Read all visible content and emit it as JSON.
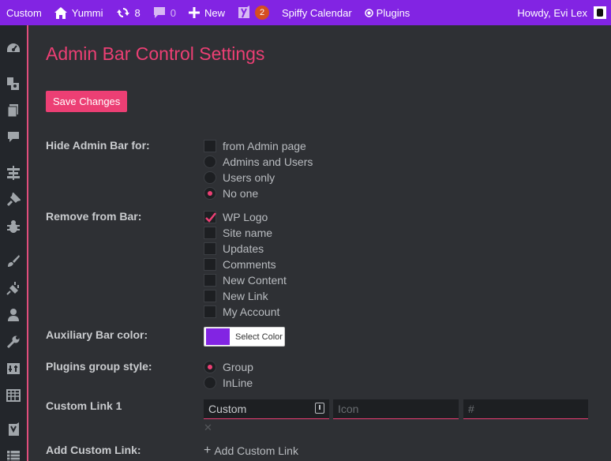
{
  "admin_bar": {
    "site_title": "Custom",
    "home_label": "Yummi",
    "updates_count": "8",
    "comments_count": "0",
    "new_label": "New",
    "yoast_badge": "2",
    "calendar_label": "Spiffy Calendar",
    "plugins_label": "Plugins",
    "greeting": "Howdy, Evi Lex",
    "bar_color": "#8224e3"
  },
  "sidebar": {
    "items": [
      "dashboard-icon",
      "yoast-icon",
      "pages-icon",
      "comments-icon",
      "woo-icon",
      "pin-icon",
      "bug-icon",
      "appearance-icon",
      "plugins-icon",
      "users-icon",
      "tools-icon",
      "settings-icon",
      "calendar-table-icon",
      "yoast-seo-icon",
      "list-icon"
    ]
  },
  "page": {
    "title": "Admin Bar Control Settings",
    "save_label": "Save Changes",
    "accent_color": "#ec3f74"
  },
  "hide_admin_bar": {
    "label": "Hide Admin Bar for:",
    "options": [
      {
        "label": "from Admin page",
        "type": "checkbox",
        "checked": false
      },
      {
        "label": "Admins and Users",
        "type": "radio",
        "checked": false
      },
      {
        "label": "Users only",
        "type": "radio",
        "checked": false
      },
      {
        "label": "No one",
        "type": "radio",
        "checked": true
      }
    ]
  },
  "remove_from_bar": {
    "label": "Remove from Bar:",
    "options": [
      {
        "label": "WP Logo",
        "checked": true
      },
      {
        "label": "Site name",
        "checked": false
      },
      {
        "label": "Updates",
        "checked": false
      },
      {
        "label": "Comments",
        "checked": false
      },
      {
        "label": "New Content",
        "checked": false
      },
      {
        "label": "New Link",
        "checked": false
      },
      {
        "label": "My Account",
        "checked": false
      }
    ]
  },
  "aux_color": {
    "label": "Auxiliary Bar color:",
    "button_label": "Select Color",
    "value": "#8224e3"
  },
  "plugins_group": {
    "label": "Plugins group style:",
    "options": [
      {
        "label": "Group",
        "checked": true
      },
      {
        "label": "InLine",
        "checked": false
      }
    ]
  },
  "custom_link": {
    "label": "Custom Link 1",
    "name_value": "Custom",
    "icon_placeholder": "Icon",
    "url_placeholder": "#",
    "remove_symbol": "✕"
  },
  "add_custom_link": {
    "label": "Add Custom Link:",
    "button_plus": "+",
    "button_label": "Add Custom Link"
  }
}
